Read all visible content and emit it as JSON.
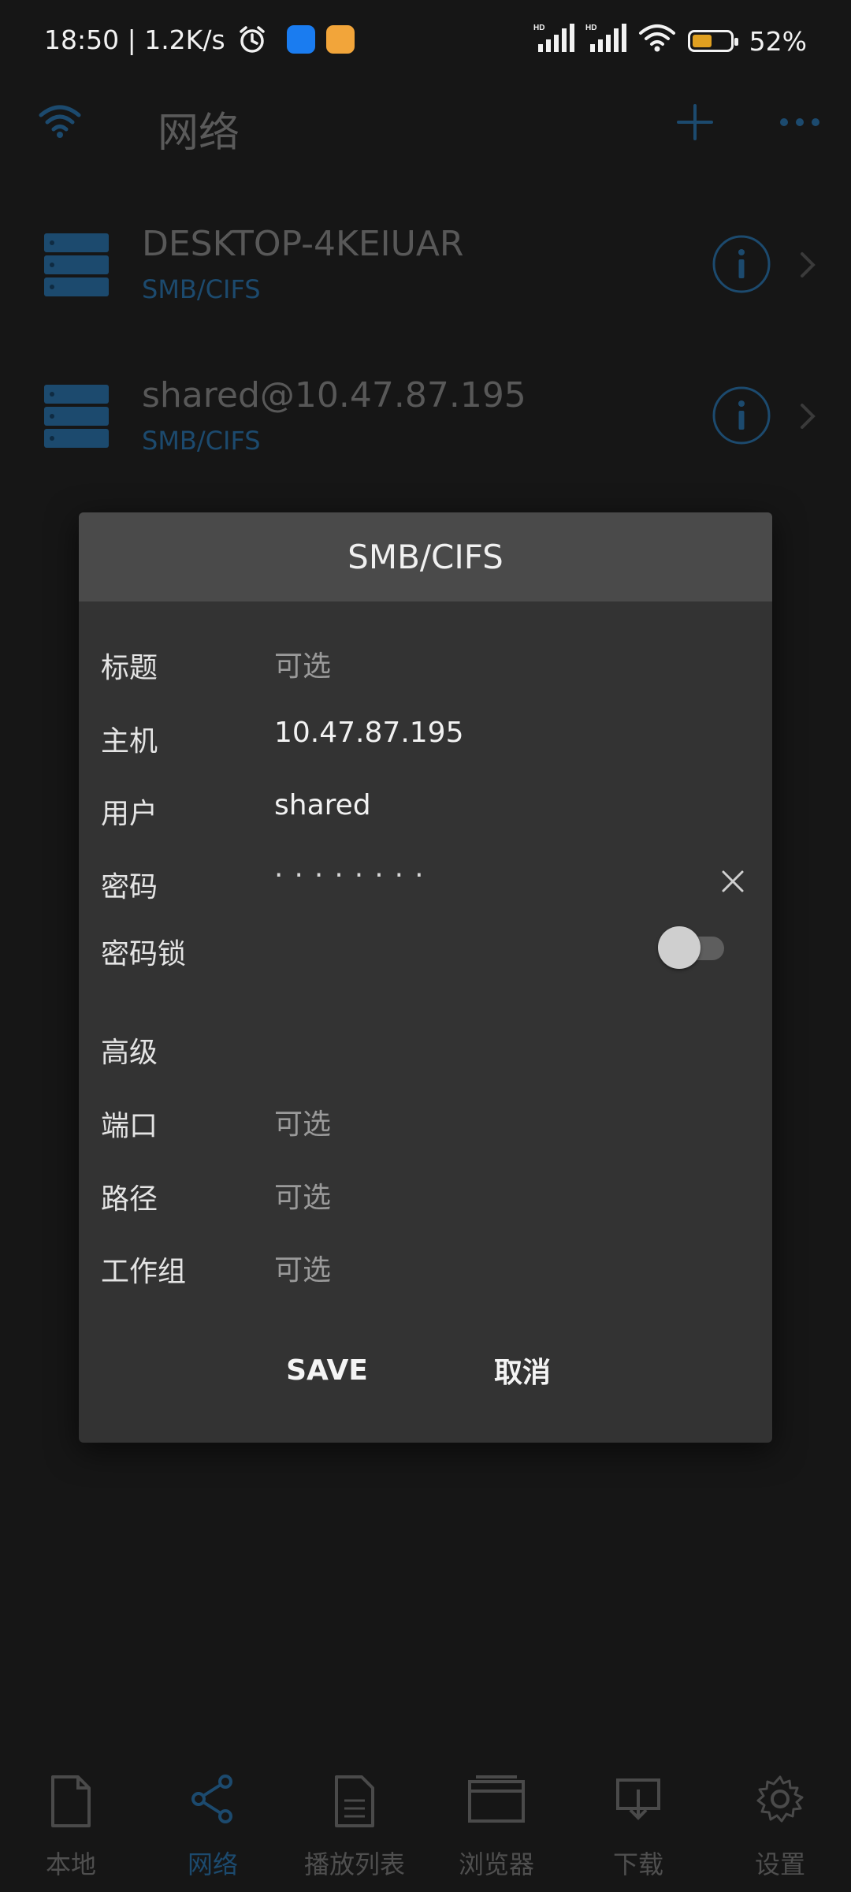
{
  "status_bar": {
    "time_speed": "18:50 | 1.2K/s",
    "battery": "52%",
    "battery_level": 0.52
  },
  "app_bar": {
    "title": "网络"
  },
  "servers": [
    {
      "name": "DESKTOP-4KEIUAR",
      "protocol": "SMB/CIFS"
    },
    {
      "name": "shared@10.47.87.195",
      "protocol": "SMB/CIFS"
    }
  ],
  "dialog": {
    "title": "SMB/CIFS",
    "fields": {
      "title": {
        "label": "标题",
        "placeholder": "可选"
      },
      "host": {
        "label": "主机",
        "value": "10.47.87.195"
      },
      "user": {
        "label": "用户",
        "value": "shared"
      },
      "password": {
        "label": "密码",
        "masked": "········"
      },
      "password_lock": {
        "label": "密码锁",
        "enabled": false
      },
      "advanced": {
        "label": "高级"
      },
      "port": {
        "label": "端口",
        "placeholder": "可选"
      },
      "path": {
        "label": "路径",
        "placeholder": "可选"
      },
      "workgroup": {
        "label": "工作组",
        "placeholder": "可选"
      }
    },
    "save_label": "SAVE",
    "cancel_label": "取消"
  },
  "bottom_nav": {
    "items": [
      {
        "label": "本地",
        "icon": "file-icon"
      },
      {
        "label": "网络",
        "icon": "share-icon",
        "active": true
      },
      {
        "label": "播放列表",
        "icon": "playlist-icon"
      },
      {
        "label": "浏览器",
        "icon": "browser-icon"
      },
      {
        "label": "下载",
        "icon": "download-icon"
      },
      {
        "label": "设置",
        "icon": "gear-icon"
      }
    ]
  },
  "colors": {
    "accent": "#1c4a6e",
    "dialog_bg": "#333333",
    "dialog_header": "#4a4a4a",
    "background": "#161616"
  }
}
